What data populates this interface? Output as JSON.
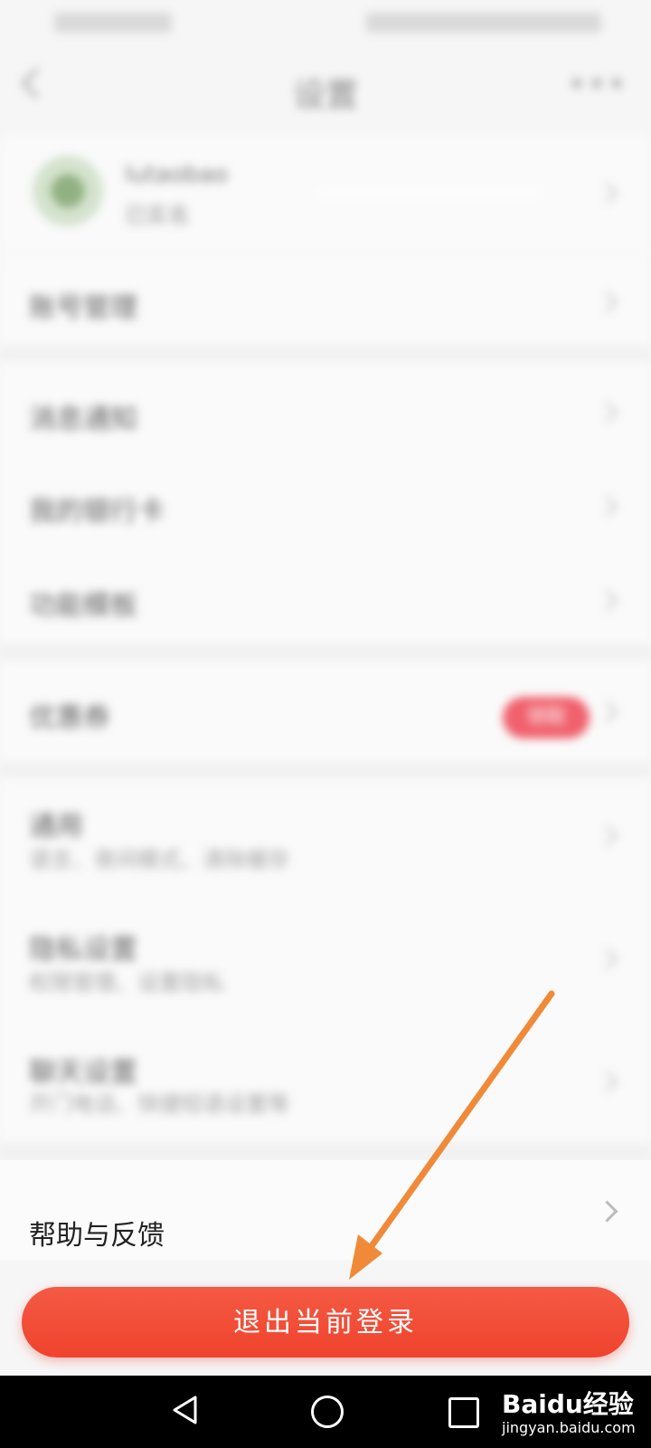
{
  "status_bar": {},
  "header": {
    "title": "设置"
  },
  "account": {
    "name": "lutaobao",
    "sub": "已实名"
  },
  "rows": [
    {
      "label": "账号管理",
      "sub": ""
    },
    {
      "label": "消息通知",
      "sub": ""
    },
    {
      "label": "我的银行卡",
      "sub": ""
    },
    {
      "label": "功能模板",
      "sub": ""
    },
    {
      "label": "优惠券",
      "sub": ""
    },
    {
      "label": "通用",
      "sub": "语言、夜间模式、清除缓存"
    },
    {
      "label": "隐私设置",
      "sub": "权限管理、设置隐私"
    },
    {
      "label": "聊天设置",
      "sub": "开门电话、快捷短语设置等"
    }
  ],
  "badge": {
    "text": "领取"
  },
  "feedback": {
    "label": "帮助与反馈"
  },
  "logout": {
    "label": "退出当前登录"
  },
  "annotation": {
    "arrow_color": "#f08a38"
  },
  "watermark": {
    "brand": "Baidu经验",
    "url": "jingyan.baidu.com"
  },
  "colors": {
    "accent": "#f0432d",
    "badge": "#ee2f3f"
  }
}
